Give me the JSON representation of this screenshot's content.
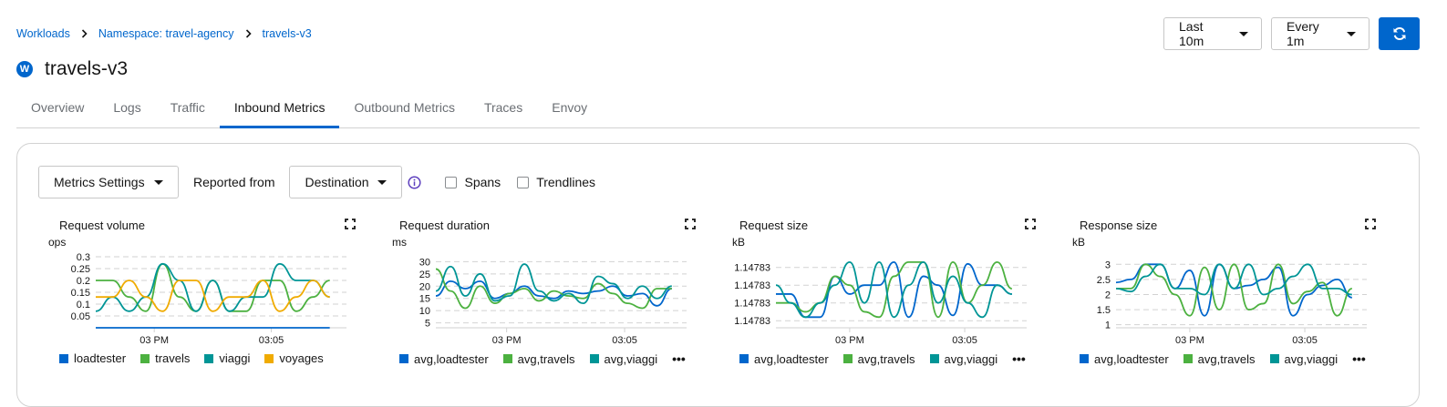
{
  "breadcrumb": {
    "items": [
      "Workloads",
      "Namespace: travel-agency",
      "travels-v3"
    ]
  },
  "header": {
    "badge": "W",
    "title": "travels-v3"
  },
  "controls": {
    "duration": "Last 10m",
    "refresh_interval": "Every 1m",
    "refresh_icon": "sync-icon"
  },
  "tabs": [
    "Overview",
    "Logs",
    "Traffic",
    "Inbound Metrics",
    "Outbound Metrics",
    "Traces",
    "Envoy"
  ],
  "active_tab": "Inbound Metrics",
  "toolbar": {
    "metrics_settings": "Metrics Settings",
    "reported_from_label": "Reported from",
    "reported_from_value": "Destination",
    "spans_label": "Spans",
    "trendlines_label": "Trendlines"
  },
  "colors": {
    "primary": "#0066cc",
    "blue": "#0066cc",
    "green": "#4cb140",
    "teal": "#009596",
    "gold": "#f0ab00",
    "info": "#5e40be"
  },
  "charts_meta": {
    "request_volume": {
      "title": "Request volume",
      "unit": "ops",
      "legend": [
        "loadtester",
        "travels",
        "viaggi",
        "voyages"
      ]
    },
    "request_duration": {
      "title": "Request duration",
      "unit": "ms",
      "legend": [
        "avg,loadtester",
        "avg,travels",
        "avg,viaggi"
      ],
      "more": "•••"
    },
    "request_size": {
      "title": "Request size",
      "unit": "kB",
      "legend": [
        "avg,loadtester",
        "avg,travels",
        "avg,viaggi"
      ],
      "more": "•••"
    },
    "response_size": {
      "title": "Response size",
      "unit": "kB",
      "legend": [
        "avg,loadtester",
        "avg,travels",
        "avg,viaggi"
      ],
      "more": "•••"
    }
  },
  "chart_data": [
    {
      "type": "line",
      "title": "Request volume",
      "ylabel": "ops",
      "yticks": [
        "0.05",
        "0.1",
        "0.15",
        "0.2",
        "0.25",
        "0.3"
      ],
      "ytick_values": [
        0.05,
        0.1,
        0.15,
        0.2,
        0.25,
        0.3
      ],
      "ylim": [
        0.0,
        0.3
      ],
      "xticks": [
        "03 PM",
        "03:05"
      ],
      "xtick_positions": [
        3.5,
        10.5
      ],
      "xlim": [
        0,
        15
      ],
      "series": [
        {
          "name": "loadtester",
          "color": "#0066cc",
          "values": [
            0,
            0,
            0,
            0,
            0,
            0,
            0,
            0,
            0,
            0,
            0,
            0,
            0,
            0,
            0
          ]
        },
        {
          "name": "travels",
          "color": "#4cb140",
          "values": [
            0.2,
            0.2,
            0.13,
            0.07,
            0.27,
            0.13,
            0.07,
            0.2,
            0.07,
            0.07,
            0.2,
            0.2,
            0.07,
            0.13,
            0.2
          ]
        },
        {
          "name": "viaggi",
          "color": "#009596",
          "values": [
            0.07,
            0.13,
            0.07,
            0.13,
            0.27,
            0.2,
            0.07,
            0.2,
            0.07,
            0.13,
            0.13,
            0.27,
            0.2,
            0.2,
            0.13
          ]
        },
        {
          "name": "voyages",
          "color": "#f0ab00",
          "values": [
            0.13,
            0.13,
            0.2,
            0.13,
            0.07,
            0.2,
            0.2,
            0.07,
            0.13,
            0.13,
            0.2,
            0.07,
            0.13,
            0.2,
            0.13
          ]
        }
      ]
    },
    {
      "type": "line",
      "title": "Request duration",
      "ylabel": "ms",
      "yticks": [
        "5",
        "10",
        "15",
        "20",
        "25",
        "30"
      ],
      "ytick_values": [
        5,
        10,
        15,
        20,
        25,
        30
      ],
      "ylim": [
        3,
        32
      ],
      "xticks": [
        "03 PM",
        "03:05"
      ],
      "xtick_positions": [
        4.8,
        12.8
      ],
      "xlim": [
        0,
        17
      ],
      "series": [
        {
          "name": "avg,loadtester",
          "color": "#0066cc",
          "values": [
            16,
            22,
            19,
            22,
            15,
            17,
            20,
            16,
            15,
            18,
            17,
            18,
            20,
            16,
            17,
            12,
            19
          ]
        },
        {
          "name": "avg,travels",
          "color": "#4cb140",
          "values": [
            27,
            18,
            11,
            20,
            13,
            17,
            19,
            14,
            18,
            16,
            15,
            21,
            17,
            13,
            11,
            19,
            19
          ]
        },
        {
          "name": "avg,viaggi",
          "color": "#009596",
          "values": [
            18,
            28,
            16,
            25,
            14,
            16,
            29,
            18,
            14,
            17,
            13,
            24,
            21,
            15,
            20,
            15,
            20
          ]
        }
      ]
    },
    {
      "type": "line",
      "title": "Request size",
      "ylabel": "kB",
      "yticks": [
        "1.14783",
        "1.14783",
        "1.14783",
        "1.14783"
      ],
      "ytick_values": [
        1,
        2,
        3,
        4
      ],
      "ylim": [
        0.6,
        4.6
      ],
      "xticks": [
        "03 PM",
        "03:05"
      ],
      "xtick_positions": [
        5,
        12.8
      ],
      "xlim": [
        0,
        17
      ],
      "series": [
        {
          "name": "avg,loadtester",
          "color": "#0066cc",
          "values": [
            2.5,
            2.5,
            1.2,
            1.2,
            3.5,
            2.5,
            3,
            3,
            4.3,
            1.2,
            3.5,
            3,
            1.3,
            4.2,
            3,
            3,
            2.5
          ]
        },
        {
          "name": "avg,travels",
          "color": "#4cb140",
          "values": [
            2,
            2,
            1.5,
            2,
            3.5,
            3,
            1.5,
            1.2,
            3.5,
            4.3,
            4.3,
            1.2,
            4.3,
            2,
            3,
            4.3,
            2.8
          ]
        },
        {
          "name": "avg,viaggi",
          "color": "#009596",
          "values": [
            3,
            2,
            1.2,
            2,
            3,
            4.3,
            2,
            4.3,
            1.2,
            3,
            4.3,
            2,
            3.5,
            2,
            1.2,
            3,
            2.5
          ]
        }
      ]
    },
    {
      "type": "line",
      "title": "Response size",
      "ylabel": "kB",
      "yticks": [
        "1",
        "1.5",
        "2",
        "2.5",
        "3"
      ],
      "ytick_values": [
        1,
        1.5,
        2,
        2.5,
        3
      ],
      "ylim": [
        0.9,
        3.25
      ],
      "xticks": [
        "03 PM",
        "03:05"
      ],
      "xtick_positions": [
        5,
        12.8
      ],
      "xlim": [
        0,
        17
      ],
      "series": [
        {
          "name": "avg,loadtester",
          "color": "#0066cc",
          "values": [
            2.4,
            2.5,
            3,
            3,
            2.2,
            2.8,
            1.3,
            3,
            2.2,
            2.3,
            2.5,
            2.9,
            1.3,
            2,
            2.3,
            2.5,
            1.9
          ]
        },
        {
          "name": "avg,travels",
          "color": "#4cb140",
          "values": [
            2.2,
            2.2,
            3,
            2.6,
            2,
            1.3,
            2.9,
            1.5,
            3,
            1.5,
            1.7,
            3,
            1.7,
            2.1,
            2.4,
            1.3,
            2.2
          ]
        },
        {
          "name": "avg,viaggi",
          "color": "#009596",
          "values": [
            2.2,
            2.1,
            2.6,
            3,
            2.2,
            2.2,
            2,
            3,
            2.2,
            3,
            2,
            2.2,
            2.6,
            3,
            2.2,
            2.2,
            2
          ]
        }
      ]
    }
  ]
}
